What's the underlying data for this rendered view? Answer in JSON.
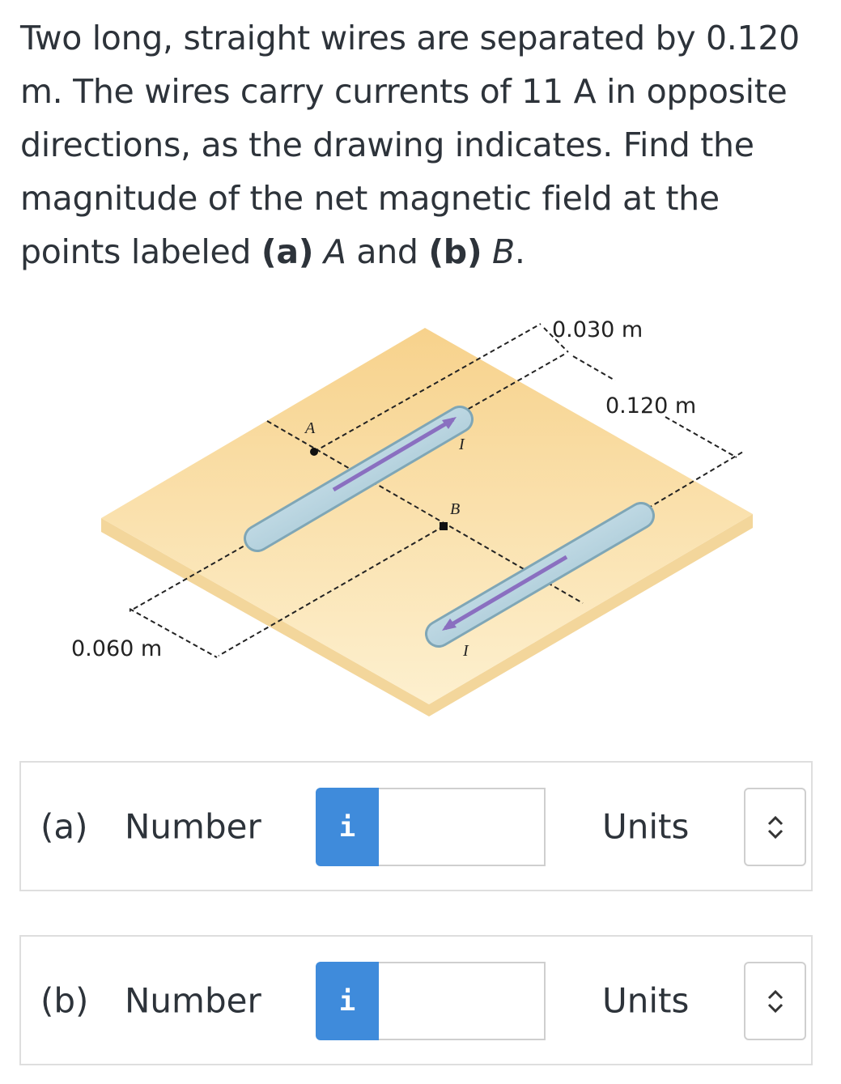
{
  "question": {
    "text_1": "Two long, straight wires are separated by 0.120 m. The wires carry currents of 11 A in opposite directions, as the drawing indicates. Find the magnitude of the net magnetic field at the points labeled ",
    "part_a": "(a)",
    "point_a": "A",
    "and": " and ",
    "part_b": "(b)",
    "point_b": "B",
    "end": "."
  },
  "figure": {
    "dim_top": "0.030 m",
    "dim_right": "0.120 m",
    "dim_left": "0.060 m",
    "label_a": "A",
    "label_b": "B",
    "current_1": "I",
    "current_2": "I",
    "plate_color": "#f8d99a",
    "wire_color": "#b9dbe8",
    "arrow_color": "#8a6fc0"
  },
  "answers": [
    {
      "part": "(a)",
      "number_label": "Number",
      "info_icon": "i",
      "value": "",
      "units_label": "Units",
      "units_value": ""
    },
    {
      "part": "(b)",
      "number_label": "Number",
      "info_icon": "i",
      "value": "",
      "units_label": "Units",
      "units_value": ""
    }
  ]
}
